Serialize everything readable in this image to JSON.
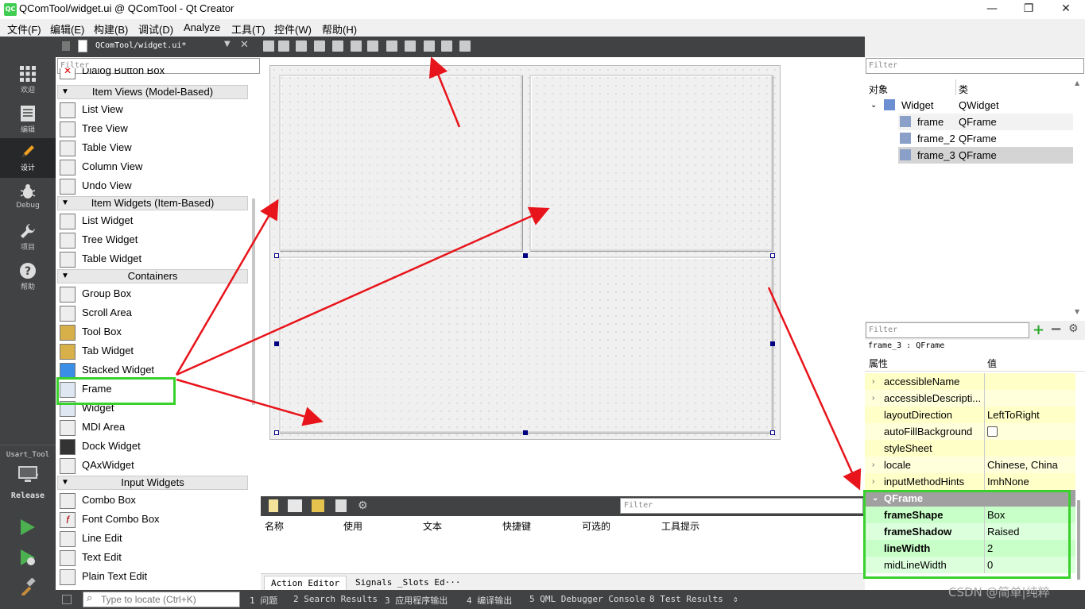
{
  "window": {
    "title": "QComTool/widget.ui @ QComTool - Qt Creator",
    "logo": "QC",
    "minimize": "—",
    "restore": "❐",
    "close": "✕"
  },
  "menu": [
    "文件(F)",
    "编辑(E)",
    "构建(B)",
    "调试(D)",
    "Analyze",
    "工具(T)",
    "控件(W)",
    "帮助(H)"
  ],
  "modes": [
    {
      "label": "欢迎",
      "icon": "grid-icon"
    },
    {
      "label": "编辑",
      "icon": "edit-doc-icon"
    },
    {
      "label": "设计",
      "icon": "pencil-icon"
    },
    {
      "label": "Debug",
      "icon": "bug-icon"
    },
    {
      "label": "项目",
      "icon": "wrench-icon"
    },
    {
      "label": "帮助",
      "icon": "help-icon"
    }
  ],
  "kit": {
    "name": "Usart_Tool",
    "config": "Release"
  },
  "editor": {
    "file": "QComTool/widget.ui*"
  },
  "widgetbox": {
    "filter_placeholder": "Filter",
    "partial_item": "Dialog Button Box",
    "categories": {
      "item_views": "Item Views (Model-Based)",
      "item_widgets": "Item Widgets (Item-Based)",
      "containers": "Containers",
      "input": "Input Widgets"
    },
    "item_views": [
      "List View",
      "Tree View",
      "Table View",
      "Column View",
      "Undo View"
    ],
    "item_widgets": [
      "List Widget",
      "Tree Widget",
      "Table Widget"
    ],
    "containers": [
      "Group Box",
      "Scroll Area",
      "Tool Box",
      "Tab Widget",
      "Stacked Widget",
      "Frame",
      "Widget",
      "MDI Area",
      "Dock Widget",
      "QAxWidget"
    ],
    "input": [
      "Combo Box",
      "Font Combo Box",
      "Line Edit",
      "Text Edit",
      "Plain Text Edit"
    ]
  },
  "action_editor": {
    "filter_placeholder": "Filter",
    "columns": [
      "名称",
      "使用",
      "文本",
      "快捷键",
      "可选的",
      "工具提示"
    ],
    "tabs": [
      "Action Editor",
      "Signals _Slots Ed···"
    ]
  },
  "object_inspector": {
    "filter_placeholder": "Filter",
    "headers": [
      "对象",
      "类"
    ],
    "rows": [
      {
        "name": "Widget",
        "class": "QWidget"
      },
      {
        "name": "frame",
        "class": "QFrame"
      },
      {
        "name": "frame_2",
        "class": "QFrame"
      },
      {
        "name": "frame_3",
        "class": "QFrame"
      }
    ]
  },
  "property_editor": {
    "filter_placeholder": "Filter",
    "object": "frame_3 : QFrame",
    "headers": [
      "属性",
      "值"
    ],
    "rows": [
      {
        "name": "accessibleName",
        "value": "",
        "expand": "›"
      },
      {
        "name": "accessibleDescripti...",
        "value": "",
        "expand": "›"
      },
      {
        "name": "layoutDirection",
        "value": "LeftToRight",
        "expand": ""
      },
      {
        "name": "autoFillBackground",
        "value": "",
        "expand": ""
      },
      {
        "name": "styleSheet",
        "value": "",
        "expand": ""
      },
      {
        "name": "locale",
        "value": "Chinese, China",
        "expand": "›"
      },
      {
        "name": "inputMethodHints",
        "value": "ImhNone",
        "expand": "›"
      }
    ],
    "section": "QFrame",
    "qframe_rows": [
      {
        "name": "frameShape",
        "value": "Box",
        "bold": true
      },
      {
        "name": "frameShadow",
        "value": "Raised",
        "bold": true
      },
      {
        "name": "lineWidth",
        "value": "2",
        "bold": true
      },
      {
        "name": "midLineWidth",
        "value": "0",
        "bold": false
      }
    ]
  },
  "statusbar": {
    "locate_placeholder": "Type to locate (Ctrl+K)",
    "panes": [
      "1 问题",
      "2 Search Results",
      "3 应用程序输出",
      "4 编译输出",
      "5 QML Debugger Console",
      "8 Test Results"
    ]
  },
  "watermark": "CSDN @简单|纯粹",
  "colors": {
    "dark": "#404244",
    "prop_yellow": "#ffffc8",
    "prop_green": "#c8ffc8",
    "qframe_header": "#a0a0a0",
    "annotation_red": "#e8141b",
    "annotation_green": "#39d12c"
  }
}
